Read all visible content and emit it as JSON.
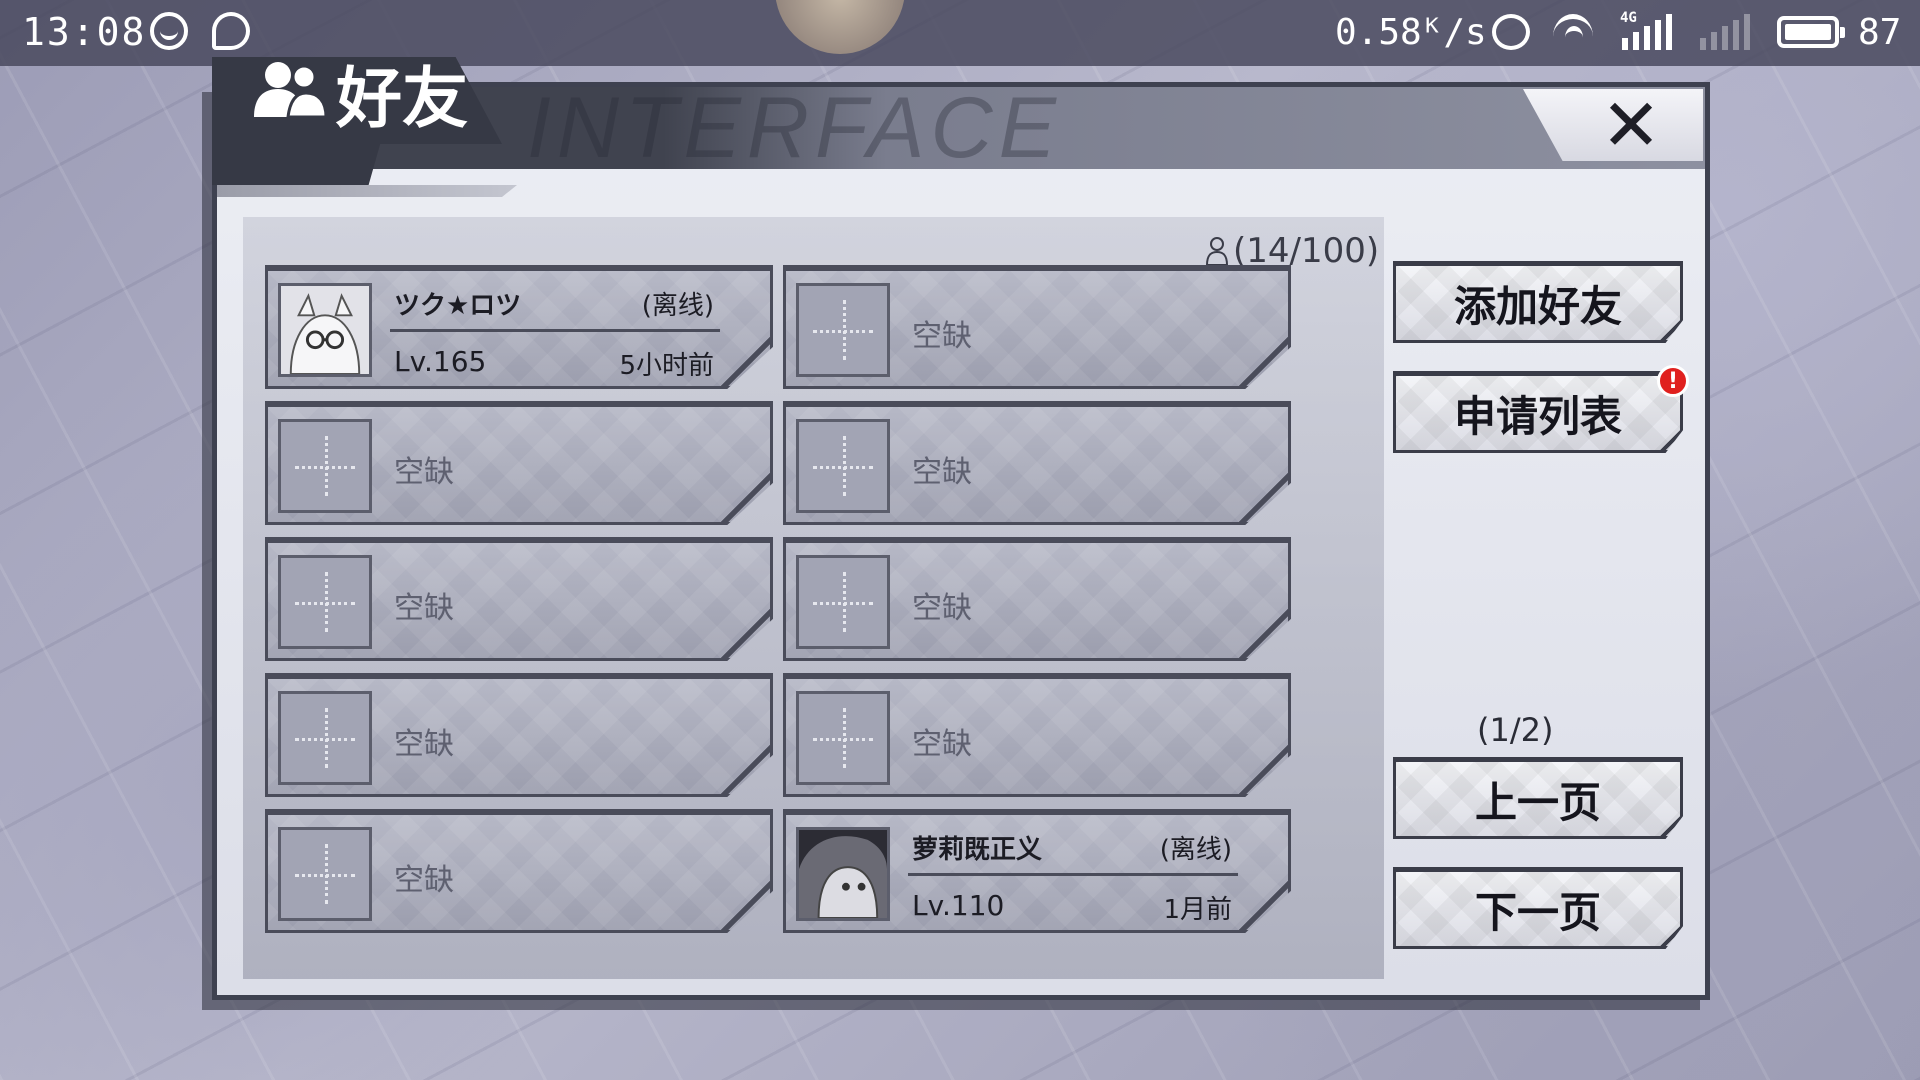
{
  "status_bar": {
    "time": "13:08",
    "net_speed": "0.58ᴷ/s",
    "network_type": "4G",
    "battery": "87"
  },
  "dialog": {
    "title": "好友",
    "header_watermark": "INTERFACE",
    "close_label": "✕",
    "friend_count": "(14/100)"
  },
  "slots": [
    {
      "type": "friend",
      "name": "ツク★ロツ",
      "status": "(离线)",
      "level": "Lv.165",
      "last_seen": "5小时前"
    },
    {
      "type": "empty",
      "label": "空缺"
    },
    {
      "type": "empty",
      "label": "空缺"
    },
    {
      "type": "empty",
      "label": "空缺"
    },
    {
      "type": "empty",
      "label": "空缺"
    },
    {
      "type": "empty",
      "label": "空缺"
    },
    {
      "type": "empty",
      "label": "空缺"
    },
    {
      "type": "empty",
      "label": "空缺"
    },
    {
      "type": "empty",
      "label": "空缺"
    },
    {
      "type": "friend",
      "name": "萝莉既正义",
      "status": "(离线)",
      "level": "Lv.110",
      "last_seen": "1月前"
    }
  ],
  "side": {
    "add_friend": "添加好友",
    "request_list": "申请列表",
    "request_badge": "!",
    "page_indicator": "(1/2)",
    "prev_page": "上一页",
    "next_page": "下一页"
  },
  "colors": {
    "badge": "#e0201e",
    "header_dark": "#363945",
    "slot_border": "#4a4c5a"
  }
}
